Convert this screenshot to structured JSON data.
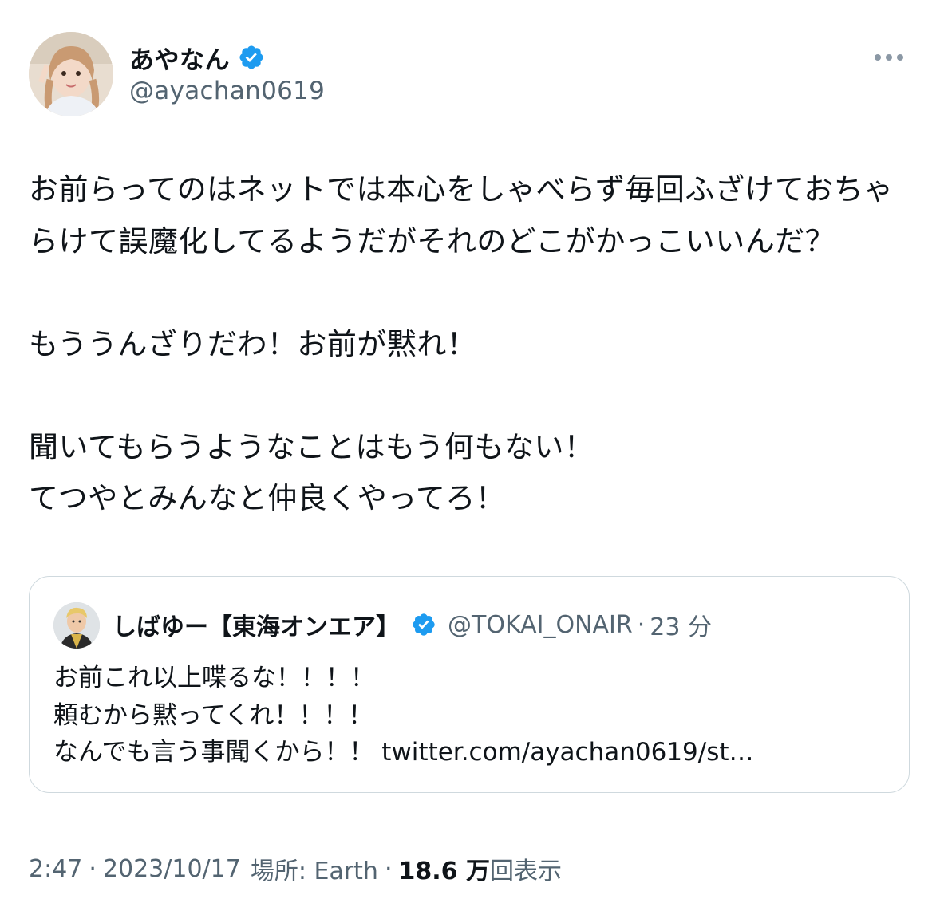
{
  "tweet": {
    "author": {
      "display_name": "あやなん",
      "handle": "@ayachan0619",
      "verified_icon": "verified-badge-icon"
    },
    "body_lines": "お前らってのはネットでは本心をしゃべらず毎回ふざけておちゃらけて誤魔化してるようだがそれのどこがかっこいいんだ？\n\nもううんざりだわ！お前が黙れ！\n\n聞いてもらうようなことはもう何もない！\nてつやとみんなと仲良くやってろ！",
    "quote": {
      "display_name": "しばゆー【東海オンエア】",
      "handle": "@TOKAI_ONAIR",
      "separator": "·",
      "time": "23 分",
      "text": "お前これ以上喋るな！！！！\n頼むから黙ってくれ！！！！\nなんでも言う事聞くから！！ twitter.com/ayachan0619/st…"
    },
    "meta": {
      "time": "2:47",
      "dot": "·",
      "date": "2023/10/17",
      "location": "場所: Earth",
      "views_number": "18.6 万",
      "views_label": "回表示"
    }
  },
  "colors": {
    "primary_text": "#0f1419",
    "secondary_text": "#536471",
    "verified_blue": "#1d9bf0",
    "border": "#cfd9de"
  }
}
